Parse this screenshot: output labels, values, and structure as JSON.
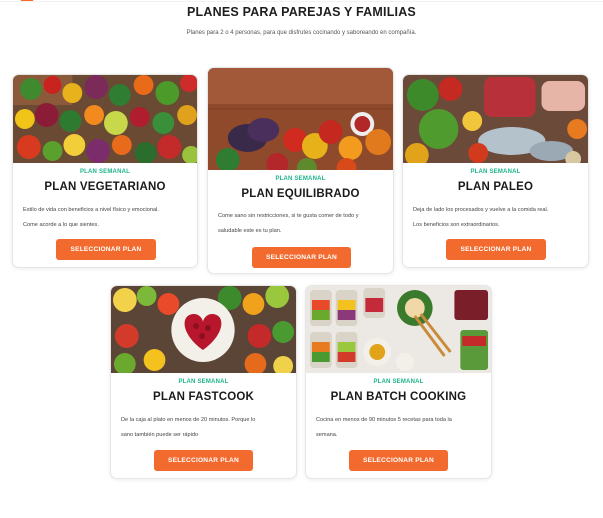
{
  "section": {
    "title": "PLANES PARA PAREJAS Y FAMILIAS",
    "subtitle": "Planes para 2 o 4 personas, para que disfrutes cocinando y saboreando en compañía."
  },
  "plans": [
    {
      "kicker": "PLAN SEMANAL",
      "name": "PLAN VEGETARIANO",
      "desc1": "Estilo de vida con beneficios a nivel físico y emocional.",
      "desc2": "Come acorde a lo que sientes.",
      "button": "SELECCIONAR PLAN",
      "image": "vegetables-photo"
    },
    {
      "kicker": "PLAN SEMANAL",
      "name": "PLAN EQUILIBRADO",
      "desc1": "Come sano sin restricciones, si te gusta comer de todo y",
      "desc2": "saludable este es tu plan.",
      "button": "SELECCIONAR PLAN",
      "image": "mixed-vegetables-photo"
    },
    {
      "kicker": "PLAN SEMANAL",
      "name": "PLAN PALEO",
      "desc1": "Deja de lado los procesados y vuelve a la comida real.",
      "desc2": "Los beneficios son extraordinarios.",
      "button": "SELECCIONAR PLAN",
      "image": "meat-fish-vegetables-photo"
    },
    {
      "kicker": "PLAN SEMANAL",
      "name": "PLAN FASTCOOK",
      "desc1": "De la caja al plato en menos de 20 minutos. Porque lo",
      "desc2": "sano también puede ser rápido",
      "button": "SELECCIONAR PLAN",
      "image": "heart-fruit-bowl-photo"
    },
    {
      "kicker": "PLAN SEMANAL",
      "name": "PLAN BATCH COOKING",
      "desc1": "Cocina en menos de 90 minutos 5 recetas para toda la",
      "desc2": "semana.",
      "button": "SELECCIONAR PLAN",
      "image": "meal-prep-jars-photo"
    }
  ],
  "colors": {
    "accent": "#f26a2e",
    "kicker": "#1cb58b",
    "title": "#1e1e1e"
  }
}
